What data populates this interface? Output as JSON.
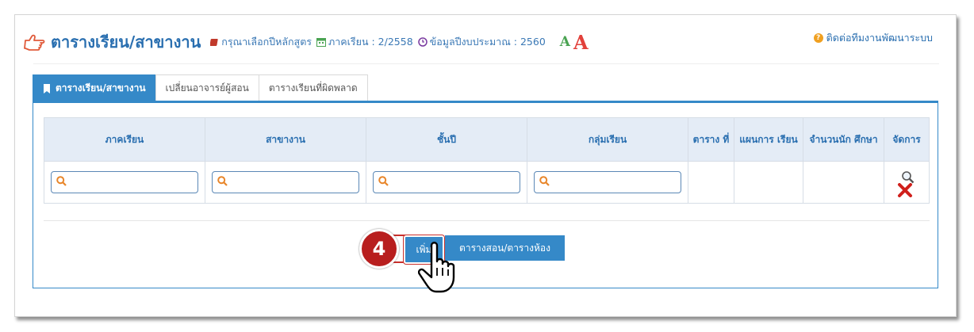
{
  "header": {
    "title": "ตารางเรียน/สาขางาน",
    "course_prompt": "กรุณาเลือกปีหลักสูตร",
    "semester_label": "ภาคเรียน : 2/2558",
    "budget_label": "ข้อมูลปีงบประมาณ : 2560",
    "font_small": "A",
    "font_large": "A",
    "contact": "ติดต่อทีมงานพัฒนาระบบ"
  },
  "tabs": [
    {
      "label": "ตารางเรียน/สาขางาน",
      "active": true
    },
    {
      "label": "เปลี่ยนอาจารย์ผู้สอน",
      "active": false
    },
    {
      "label": "ตารางเรียนที่ผิดพลาด",
      "active": false
    }
  ],
  "table": {
    "columns": [
      "ภาคเรียน",
      "สาขางาน",
      "ชั้นปี",
      "กลุ่มเรียน",
      "ตาราง ที่",
      "แผนการ เรียน",
      "จำนวนนัก ศึกษา",
      "จัดการ"
    ]
  },
  "buttons": {
    "add": "เพิ่ม",
    "schedule": "ตารางสอน/ตารางห้อง"
  },
  "step_number": "4",
  "colors": {
    "primary": "#3589c8",
    "accent_red": "#b81e1e",
    "header_bg": "#e4ecf6"
  }
}
